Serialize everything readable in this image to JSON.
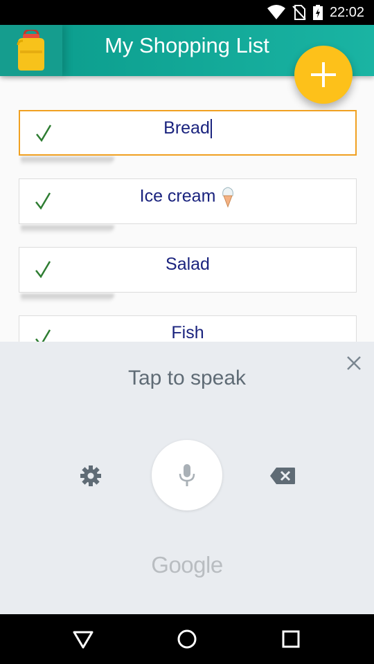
{
  "status_bar": {
    "time": "22:02",
    "icons": [
      "wifi-icon",
      "no-sim-icon",
      "battery-charging-icon"
    ]
  },
  "app_bar": {
    "title": "My Shopping List",
    "logo_icon": "shopping-bag-icon",
    "fab_icon": "plus-icon"
  },
  "list": {
    "items": [
      {
        "label": "Bread",
        "checked": true,
        "focused": true
      },
      {
        "label": "Ice cream",
        "checked": true,
        "emoji": "ice-cream-icon"
      },
      {
        "label": "Salad",
        "checked": true
      },
      {
        "label": "Fish",
        "checked": true
      }
    ]
  },
  "voice_input": {
    "prompt": "Tap to speak",
    "brand": "Google"
  },
  "nav_bar": {
    "buttons": [
      "back-icon",
      "home-icon",
      "recents-icon"
    ]
  },
  "colors": {
    "app_bar": "#0a9b8b",
    "fab": "#fdc11a",
    "item_text": "#1a237e",
    "check": "#2e7d32",
    "focus_border": "#f0a020"
  }
}
